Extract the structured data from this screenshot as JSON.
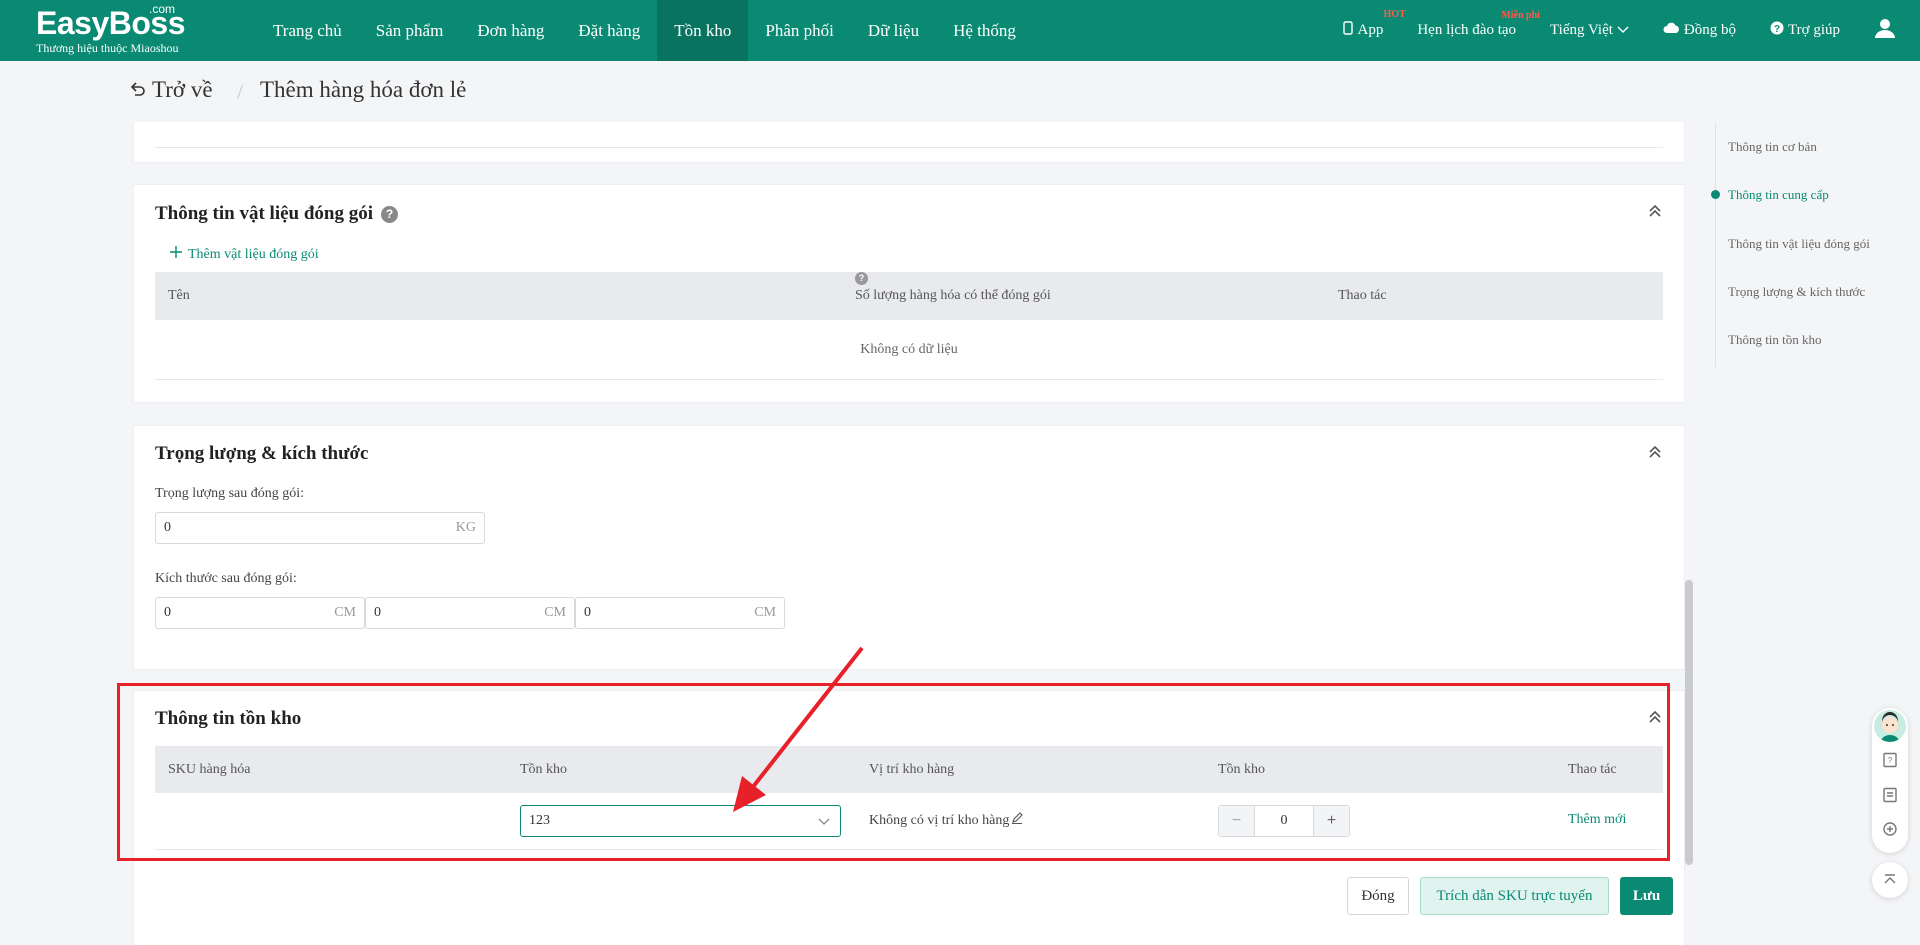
{
  "topnav": {
    "logo_main": "EasyBoss",
    "logo_com": ".com",
    "logo_sub": "Thương hiệu thuộc Miaoshou",
    "items": [
      "Trang chủ",
      "Sản phẩm",
      "Đơn hàng",
      "Đặt hàng",
      "Tồn kho",
      "Phân phối",
      "Dữ liệu",
      "Hệ thống"
    ],
    "active_index": 4,
    "app_label": "App",
    "app_badge": "HOT",
    "training_label": "Hẹn lịch đào tạo",
    "training_badge": "Miễn phí",
    "language": "Tiếng Việt",
    "sync": "Đồng bộ",
    "help": "Trợ giúp"
  },
  "header": {
    "back": "Trở về",
    "separator": "/",
    "title": "Thêm hàng hóa đơn lẻ"
  },
  "packaging": {
    "title": "Thông tin vật liệu đóng gói",
    "add_link": "Thêm vật liệu đóng gói",
    "col_name": "Tên",
    "col_qty": "Số lượng hàng hóa có thể đóng gói",
    "col_action": "Thao tác",
    "empty": "Không có dữ liệu"
  },
  "weight": {
    "title": "Trọng lượng & kích thước",
    "weight_label": "Trọng lượng sau đóng gói:",
    "weight_value": "0",
    "weight_unit": "KG",
    "size_label": "Kích thước sau đóng gói:",
    "size_values": [
      "0",
      "0",
      "0"
    ],
    "size_unit": "CM"
  },
  "inventory": {
    "title": "Thông tin tồn kho",
    "col_sku": "SKU hàng hóa",
    "col_warehouse": "Tồn kho",
    "col_location": "Vị trí kho hàng",
    "col_stock": "Tồn kho",
    "col_action": "Thao tác",
    "warehouse_value": "123",
    "location_value": "Không có vị trí kho hàng",
    "stock_value": "0",
    "stock_minus": "−",
    "stock_plus": "+",
    "add_new": "Thêm mới"
  },
  "anchor_nav": {
    "items": [
      "Thông tin cơ bản",
      "Thông tin cung cấp",
      "Thông tin vật liệu đóng gói",
      "Trọng lượng & kích thước",
      "Thông tin tồn kho"
    ],
    "active_index": 1
  },
  "footer": {
    "close": "Đóng",
    "cite": "Trích dẫn SKU trực tuyến",
    "save": "Lưu"
  },
  "colors": {
    "brand": "#0a8a73",
    "highlight": "#e8202a"
  }
}
